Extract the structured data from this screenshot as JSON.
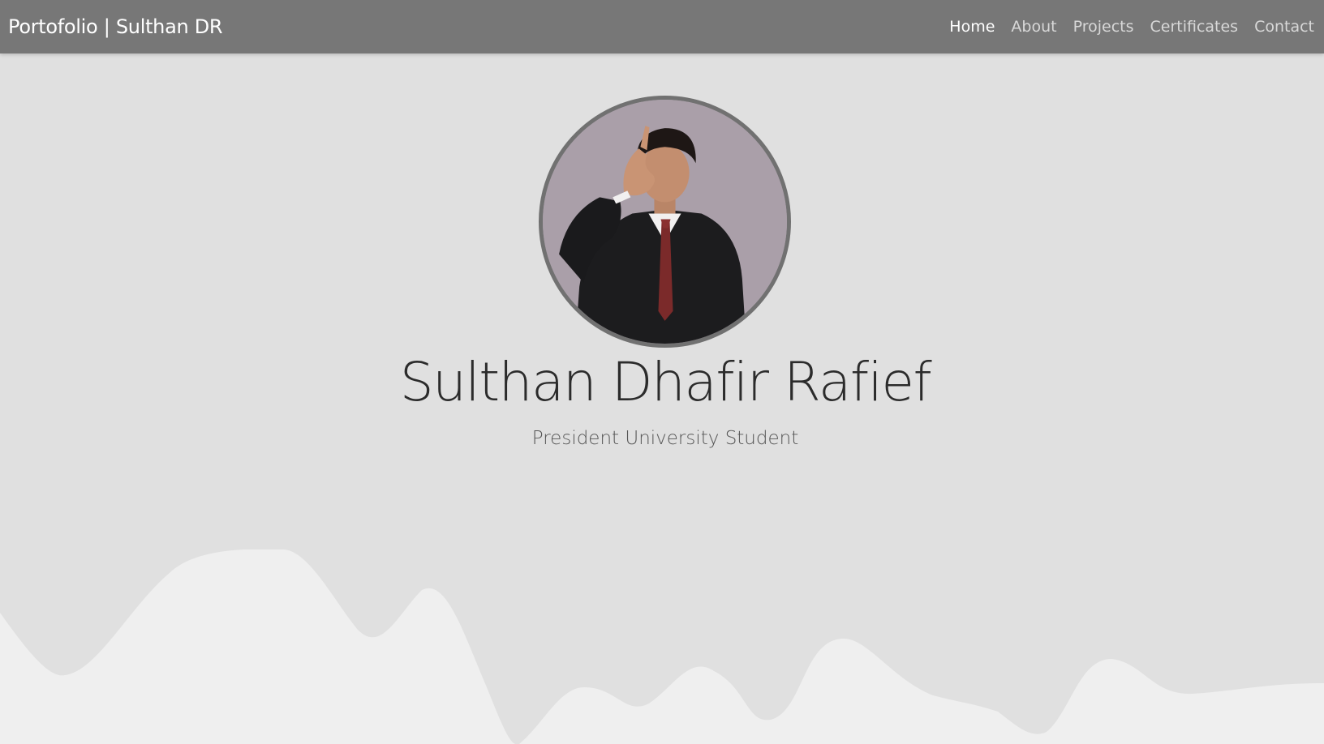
{
  "navbar": {
    "brand": "Portofolio | Sulthan DR",
    "items": [
      {
        "label": "Home",
        "active": true
      },
      {
        "label": "About",
        "active": false
      },
      {
        "label": "Projects",
        "active": false
      },
      {
        "label": "Certificates",
        "active": false
      },
      {
        "label": "Contact",
        "active": false
      }
    ]
  },
  "hero": {
    "name": "Sulthan Dhafir Rafief",
    "subtitle": "President University Student"
  },
  "colors": {
    "navbar_bg": "#777777",
    "page_bg": "#e0e0e0",
    "wave_fill": "#efefef",
    "avatar_border": "#717171"
  }
}
